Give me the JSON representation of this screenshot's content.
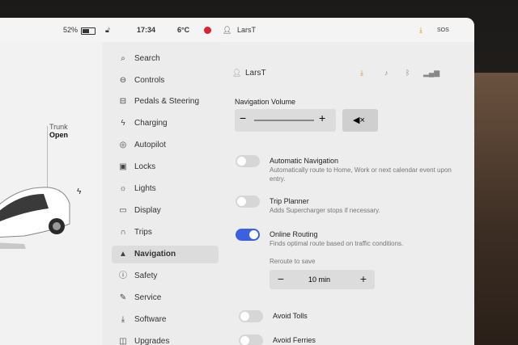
{
  "status": {
    "battery": "52%",
    "time": "17:34",
    "temp": "6°C",
    "user": "LarsT",
    "sos": "SOS"
  },
  "car": {
    "trunk_label": "Trunk",
    "trunk_state": "Open"
  },
  "menu": {
    "items": [
      {
        "label": "Search",
        "icon": "search-icon"
      },
      {
        "label": "Controls",
        "icon": "toggle-icon"
      },
      {
        "label": "Pedals & Steering",
        "icon": "car-icon"
      },
      {
        "label": "Charging",
        "icon": "bolt-icon"
      },
      {
        "label": "Autopilot",
        "icon": "steering-wheel-icon"
      },
      {
        "label": "Locks",
        "icon": "lock-icon"
      },
      {
        "label": "Lights",
        "icon": "sun-icon"
      },
      {
        "label": "Display",
        "icon": "display-icon"
      },
      {
        "label": "Trips",
        "icon": "trips-icon"
      },
      {
        "label": "Navigation",
        "icon": "navigation-arrow-icon"
      },
      {
        "label": "Safety",
        "icon": "safety-icon"
      },
      {
        "label": "Service",
        "icon": "wrench-icon"
      },
      {
        "label": "Software",
        "icon": "download-icon"
      },
      {
        "label": "Upgrades",
        "icon": "bag-icon"
      }
    ],
    "active": "Navigation"
  },
  "content": {
    "user": "LarsT",
    "nav_volume_label": "Navigation Volume",
    "auto_nav": {
      "title": "Automatic Navigation",
      "desc": "Automatically route to Home, Work or next calendar event upon entry."
    },
    "trip_planner": {
      "title": "Trip Planner",
      "desc": "Adds Supercharger stops if necessary."
    },
    "online_routing": {
      "title": "Online Routing",
      "desc": "Finds optimal route based on traffic conditions."
    },
    "reroute_label": "Reroute to save",
    "reroute_value": "10 min",
    "avoid_tolls": "Avoid Tolls",
    "avoid_ferries": "Avoid Ferries",
    "minus": "−",
    "plus": "+"
  },
  "colors": {
    "accent": "#3b61e0",
    "record": "#d9232e",
    "download": "#e08a1c"
  }
}
